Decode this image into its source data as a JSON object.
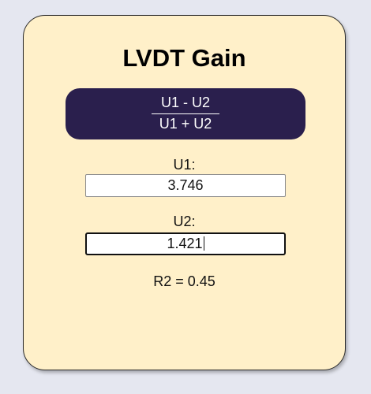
{
  "app": {
    "title": "LVDT Gain"
  },
  "formula": {
    "numerator": "U1 - U2",
    "denominator": "U1 + U2"
  },
  "inputs": {
    "u1": {
      "label": "U1:",
      "value": "3.746"
    },
    "u2": {
      "label": "U2:",
      "value": "1.421"
    }
  },
  "result": {
    "name": "R2",
    "separator": " = ",
    "value": "0.45"
  },
  "colors": {
    "page_background": "#e5e7f0",
    "card_background": "#fff0c9",
    "formula_background": "#2a1f4d",
    "formula_text": "#ffffff"
  }
}
